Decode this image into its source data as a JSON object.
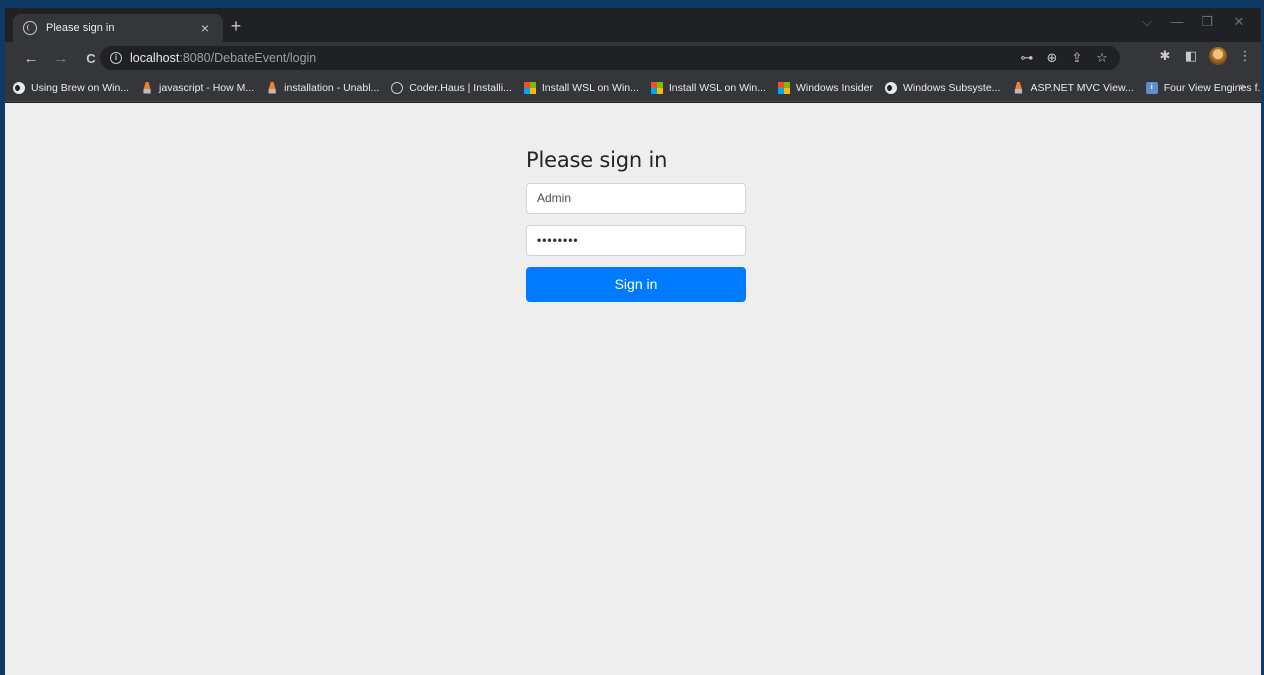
{
  "tab": {
    "title": "Please sign in",
    "close": "×",
    "new": "+"
  },
  "window_controls": {
    "dropdown": "⌵",
    "minimize": "—",
    "restore": "❐",
    "close": "✕"
  },
  "nav": {
    "back": "←",
    "forward": "→",
    "reload": "C"
  },
  "address": {
    "host": "localhost",
    "rest": ":8080/DebateEvent/login",
    "info": "i"
  },
  "toolbar_icons": {
    "key": "⊶",
    "zoom": "⊕",
    "share": "⇪",
    "star": "☆",
    "extensions": "✱",
    "sidepanel": "◧",
    "menu": "⋮"
  },
  "bookmarks": [
    {
      "label": "Using Brew on Win...",
      "icon": "medium"
    },
    {
      "label": "javascript - How M...",
      "icon": "so"
    },
    {
      "label": "installation - Unabl...",
      "icon": "so"
    },
    {
      "label": "Coder.Haus | Installi...",
      "icon": "globe"
    },
    {
      "label": "Install WSL on Win...",
      "icon": "ms"
    },
    {
      "label": "Install WSL on Win...",
      "icon": "ms"
    },
    {
      "label": "Windows Insider",
      "icon": "ms"
    },
    {
      "label": "Windows Subsyste...",
      "icon": "medium"
    },
    {
      "label": "ASP.NET MVC View...",
      "icon": "so"
    },
    {
      "label": "Four View Engines f...",
      "icon": "info"
    }
  ],
  "bookmarks_more": "»",
  "login": {
    "heading": "Please sign in",
    "username_value": "Admin",
    "password_mask": "••••••••",
    "submit_label": "Sign in"
  },
  "colors": {
    "primary": "#007bff",
    "page_bg": "#eeeeee",
    "chrome_dark": "#202124",
    "chrome_toolbar": "#35363a"
  }
}
